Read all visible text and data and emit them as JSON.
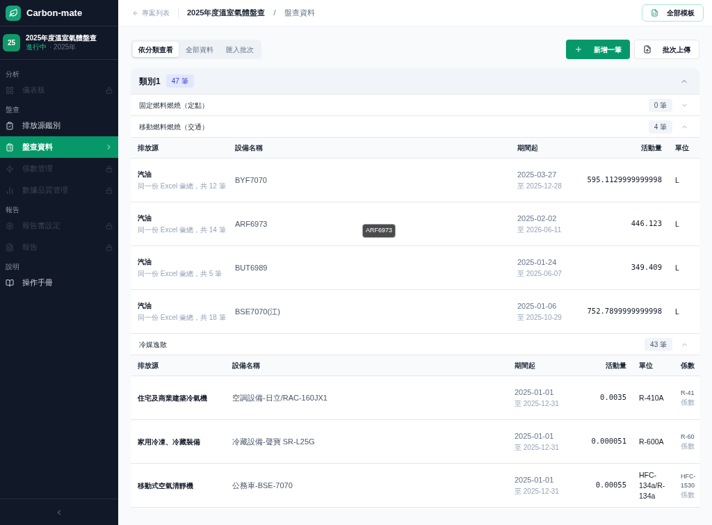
{
  "sidebar": {
    "brand": "Carbon-mate",
    "project": {
      "badge": "25",
      "title": "2025年度溫室氣體盤查",
      "status": "進行中",
      "year": "· 2025年"
    },
    "sections": [
      {
        "label": "分析",
        "items": [
          {
            "label": "儀表板",
            "locked": true,
            "selected": false
          }
        ]
      },
      {
        "label": "盤查",
        "items": [
          {
            "label": "排放源鑑別",
            "locked": false,
            "selected": false
          },
          {
            "label": "盤查資料",
            "locked": false,
            "selected": true
          },
          {
            "label": "係數管理",
            "locked": true,
            "selected": false
          },
          {
            "label": "數據品質管理",
            "locked": true,
            "selected": false
          }
        ]
      },
      {
        "label": "報告",
        "items": [
          {
            "label": "報告書設定",
            "locked": true,
            "selected": false
          },
          {
            "label": "報告",
            "locked": true,
            "selected": false
          }
        ]
      },
      {
        "label": "說明",
        "items": [
          {
            "label": "操作手冊",
            "locked": false,
            "selected": false
          }
        ]
      }
    ]
  },
  "header": {
    "back": "專案列表",
    "breadcrumb": [
      "2025年度溫室氣體盤查",
      "盤查資料"
    ],
    "separator": "/",
    "template_button": "全部模板"
  },
  "tabs": [
    {
      "label": "依分類查看",
      "selected": true
    },
    {
      "label": "全部資料",
      "selected": false
    },
    {
      "label": "匯入批次",
      "selected": false
    }
  ],
  "actions": {
    "add": "新增一筆",
    "upload": "批次上傳"
  },
  "category": {
    "title": "類別1",
    "count": "47 筆",
    "expanded": true
  },
  "groups": [
    {
      "title": "固定燃料燃燒（定點）",
      "count": "0 筆",
      "expanded": false
    },
    {
      "title": "移動燃料燃燒（交通）",
      "count": "4 筆",
      "expanded": true,
      "columns": [
        "排放源",
        "設備名稱",
        "期間起",
        "活動量",
        "單位"
      ],
      "rows": [
        {
          "source": "汽油",
          "note": "同一份 Excel 彙總，共 12 筆",
          "device": "BYF7070",
          "start": "2025-03-27",
          "end": "至 2025-12-28",
          "amount": "595.1129999999998",
          "unit": "L"
        },
        {
          "source": "汽油",
          "note": "同一份 Excel 彙總，共 14 筆",
          "device": "ARF6973",
          "start": "2025-02-02",
          "end": "至 2026-06-11",
          "amount": "446.123",
          "unit": "L",
          "tooltip": "ARF6973"
        },
        {
          "source": "汽油",
          "note": "同一份 Excel 彙總，共 5 筆",
          "device": "BUT6989",
          "start": "2025-01-24",
          "end": "至 2025-06-07",
          "amount": "349.409",
          "unit": "L"
        },
        {
          "source": "汽油",
          "note": "同一份 Excel 彙總，共 18 筆",
          "device": "BSE7070(江)",
          "start": "2025-01-06",
          "end": "至 2025-10-29",
          "amount": "752.7899999999998",
          "unit": "L"
        }
      ]
    },
    {
      "title": "冷媒逸散",
      "count": "43 筆",
      "expanded": true,
      "columns": [
        "排放源",
        "設備名稱",
        "期間起",
        "活動量",
        "單位",
        "係數"
      ],
      "rows": [
        {
          "source": "住宅及商業建築冷氣機",
          "device": "空調設備-日立/RAC-160JX1",
          "start": "2025-01-01",
          "end": "至 2025-12-31",
          "amount": "0.0035",
          "unit": "R-410A",
          "factor": [
            "R-41",
            "係數"
          ]
        },
        {
          "source": "家用冷凍、冷藏裝備",
          "device": "冷藏設備-聲寶 SR-L25G",
          "start": "2025-01-01",
          "end": "至 2025-12-31",
          "amount": "0.000051",
          "unit": "R-600A",
          "factor": [
            "R-60",
            "係數"
          ]
        },
        {
          "source": "移動式空氣清靜機",
          "device": "公務車-BSE-7070",
          "start": "2025-01-01",
          "end": "至 2025-12-31",
          "amount": "0.00055",
          "unit": "HFC-134a/R-134a",
          "factor": [
            "HFC-",
            "1530",
            "係數"
          ]
        }
      ]
    }
  ]
}
